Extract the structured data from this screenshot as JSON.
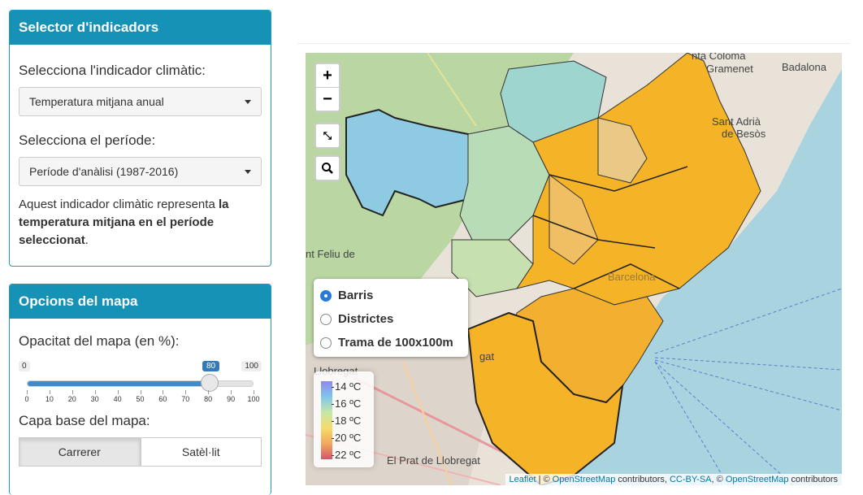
{
  "selector_panel": {
    "title": "Selector d'indicadors",
    "indicator_label": "Selecciona l'indicador climàtic:",
    "indicator_value": "Temperatura mitjana anual",
    "period_label": "Selecciona el període:",
    "period_value": "Període d'anàlisi (1987-2016)",
    "description_prefix": "Aquest indicador climàtic representa ",
    "description_bold": "la temperatura mitjana en el període seleccionat",
    "description_suffix": "."
  },
  "map_options_panel": {
    "title": "Opcions del mapa",
    "opacity_label": "Opacitat del mapa (en %):",
    "slider": {
      "min": 0,
      "max": 100,
      "value": 80,
      "ticks": [
        "0",
        "10",
        "20",
        "30",
        "40",
        "50",
        "60",
        "70",
        "80",
        "90",
        "100"
      ]
    },
    "basemap_label": "Capa base del mapa:",
    "basemap_options": [
      "Carrerer",
      "Satèl·lit"
    ],
    "basemap_selected": "Carrerer"
  },
  "map": {
    "zoom_in": "+",
    "zoom_out": "−",
    "layer_control": {
      "options": [
        "Barris",
        "Districtes",
        "Trama de 100x100m"
      ],
      "selected": "Barris"
    },
    "legend": [
      "14 ºC",
      "16 ºC",
      "18 ºC",
      "20 ºC",
      "22 ºC"
    ],
    "place_labels": [
      "nta Coloma",
      "Gramenet",
      "Badalona",
      "Sant Adrià",
      "de Besòs",
      "Barcelona",
      "nt Feliu de",
      "gat",
      "Llobregat",
      "El Prat de Llobregat"
    ],
    "attribution": {
      "leaflet": "Leaflet",
      "sep1": " | © ",
      "osm1": "OpenStreetMap",
      "text1": " contributors, ",
      "license": "CC-BY-SA",
      "sep2": ", © ",
      "osm2": "OpenStreetMap",
      "text2": " contributors"
    }
  },
  "colors": {
    "panel_header": "#1592b6",
    "choropleth_warm": "#f5b327",
    "choropleth_cool": "#7fc6e9",
    "sea": "#a9d3de"
  }
}
